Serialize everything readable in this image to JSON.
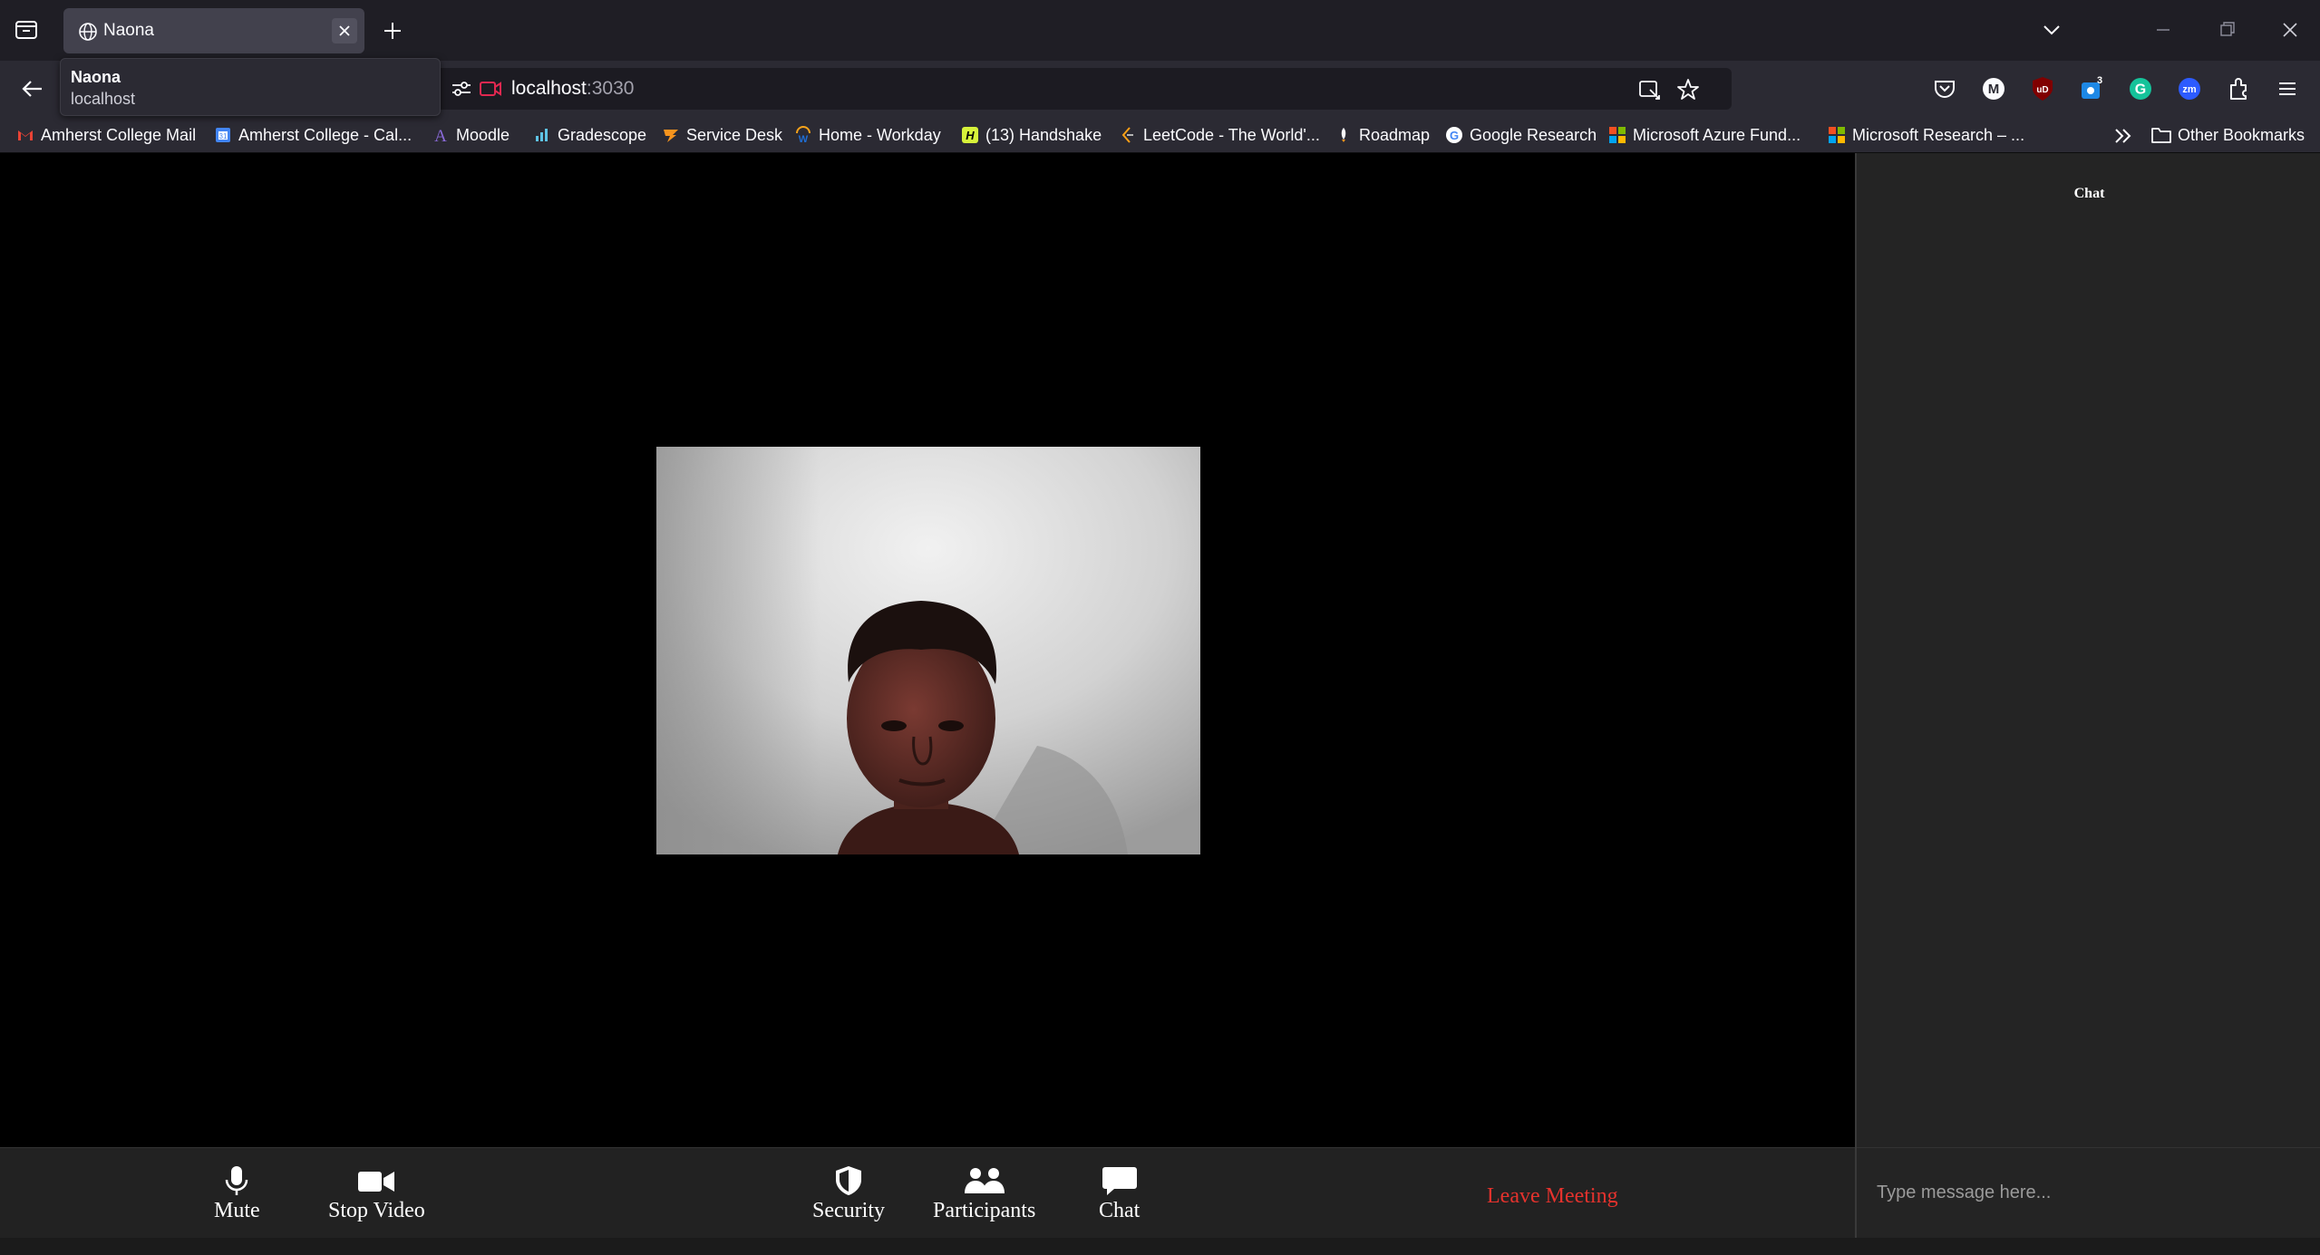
{
  "browser": {
    "tab": {
      "title": "Naona"
    },
    "tooltip": {
      "title": "Naona",
      "host": "localhost"
    },
    "url": {
      "host": "localhost",
      "port": ":3030"
    },
    "extensions": [
      {
        "name": "pocket-icon"
      },
      {
        "name": "m-extension-icon",
        "text": "M"
      },
      {
        "name": "ublock-icon",
        "text": "uD"
      },
      {
        "name": "badge-extension-icon",
        "badge": "3"
      },
      {
        "name": "grammarly-icon",
        "text": "G"
      },
      {
        "name": "zoom-extension-icon",
        "text": "zm"
      },
      {
        "name": "extensions-icon"
      },
      {
        "name": "menu-icon"
      }
    ],
    "bookmarks": [
      {
        "label": "Amherst College Mail",
        "icon": "gmail-icon",
        "color": "#ea4335"
      },
      {
        "label": "Amherst College - Cal...",
        "icon": "calendar-icon",
        "color": "#4285f4"
      },
      {
        "label": "Moodle",
        "icon": "moodle-icon",
        "color": "#4b2e83"
      },
      {
        "label": "Gradescope",
        "icon": "gradescope-icon",
        "color": "#5ec3e5"
      },
      {
        "label": "Service Desk",
        "icon": "service-desk-icon",
        "color": "#f7941d"
      },
      {
        "label": "Home - Workday",
        "icon": "workday-icon",
        "color": "#f6a31b"
      },
      {
        "label": "(13) Handshake",
        "icon": "handshake-icon",
        "color": "#d7f23a"
      },
      {
        "label": "LeetCode - The World'...",
        "icon": "leetcode-icon",
        "color": "#ffa116"
      },
      {
        "label": "Roadmap",
        "icon": "roadmap-icon",
        "color": "#ffffff"
      },
      {
        "label": "Google Research",
        "icon": "google-icon",
        "color": "#4285f4"
      },
      {
        "label": "Microsoft Azure Fund...",
        "icon": "microsoft-icon",
        "color": "#f25022"
      },
      {
        "label": "Microsoft Research – ...",
        "icon": "microsoft-icon",
        "color": "#f25022"
      }
    ],
    "other_bookmarks": "Other Bookmarks"
  },
  "meeting": {
    "toolbar": {
      "mute": "Mute",
      "stop_video": "Stop Video",
      "security": "Security",
      "participants": "Participants",
      "chat": "Chat",
      "leave": "Leave Meeting"
    },
    "chat_panel": {
      "title": "Chat",
      "input_placeholder": "Type message here..."
    }
  },
  "colors": {
    "leave": "#e5322d",
    "toolbar_bg": "#222222",
    "chat_bg": "#242424",
    "video_bg": "#000000"
  }
}
